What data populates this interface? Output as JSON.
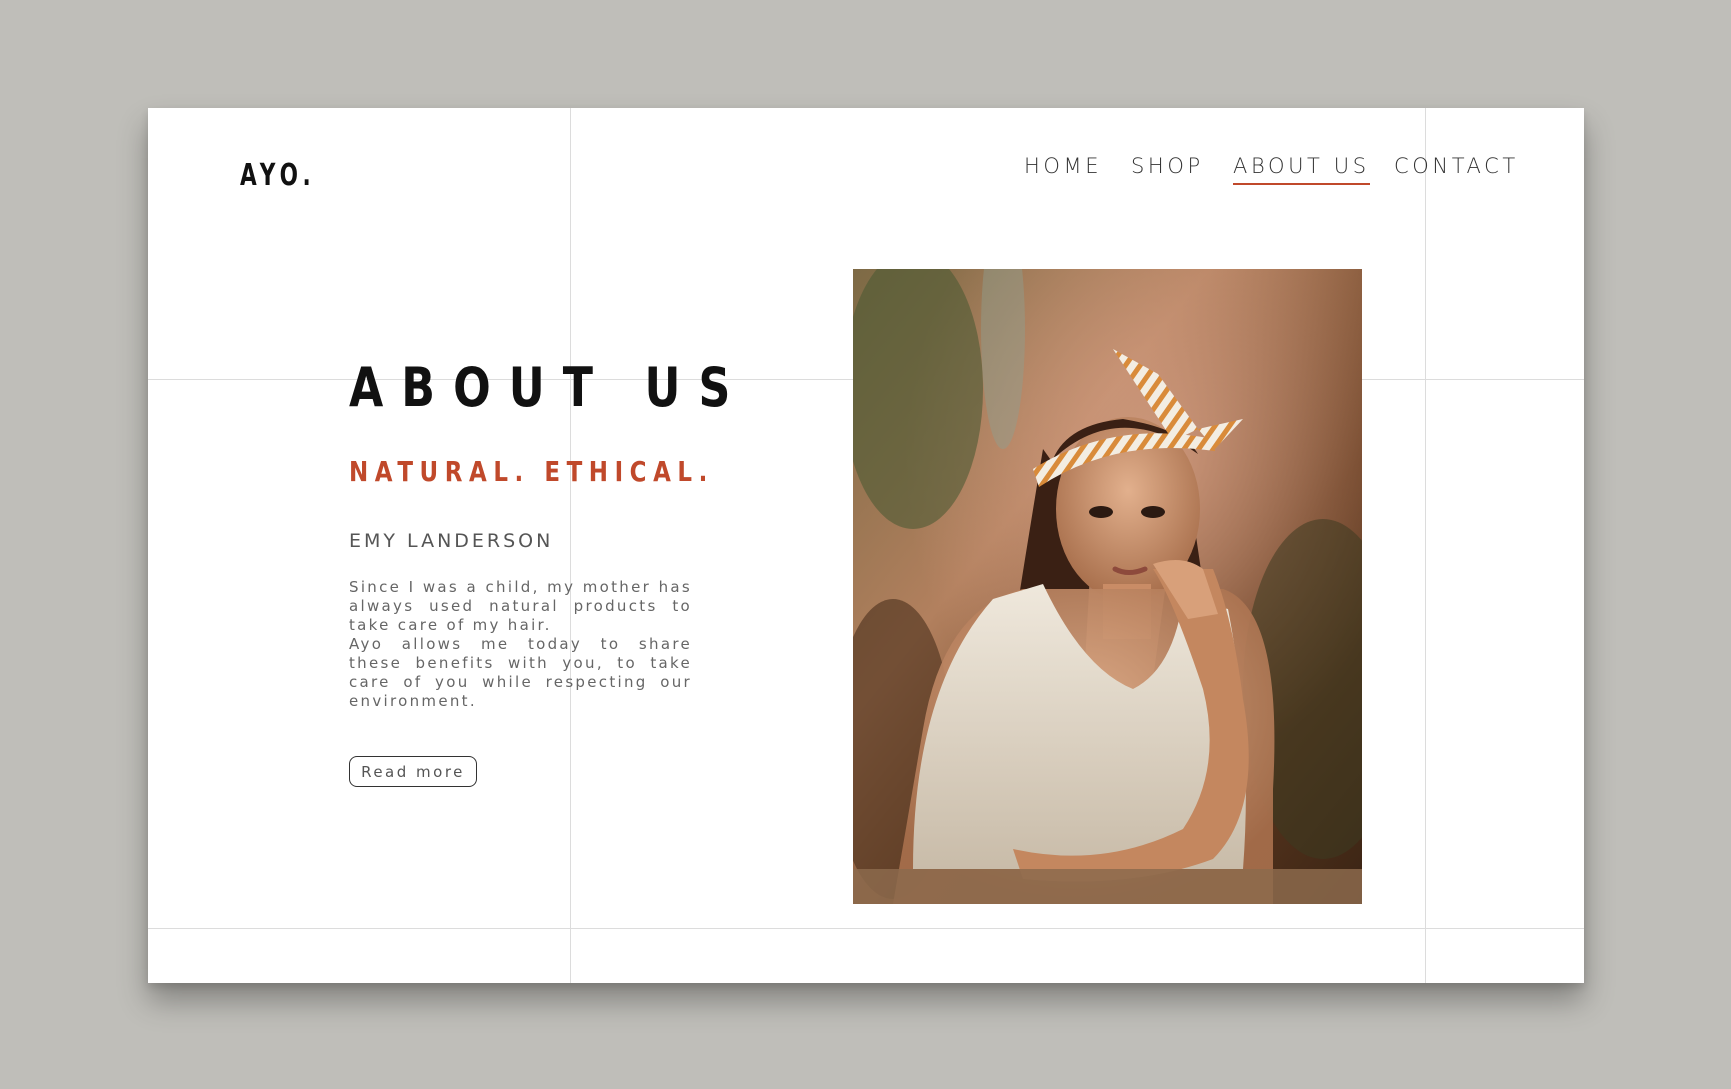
{
  "brand": {
    "logo": "AYO."
  },
  "nav": {
    "items": [
      {
        "label": "HOME",
        "active": false
      },
      {
        "label": "SHOP",
        "active": false
      },
      {
        "label": "ABOUT US",
        "active": true
      },
      {
        "label": "CONTACT",
        "active": false
      }
    ]
  },
  "hero": {
    "title": "ABOUT US",
    "tagline": "NATURAL. ETHICAL.",
    "author": "EMY LANDERSON",
    "paragraphs": [
      "Since I was a child, my mother has always used natural products to take care of my hair.",
      "Ayo allows me today to share these benefits with you, to take care of you while respecting our environment."
    ],
    "read_more_label": "Read more"
  },
  "colors": {
    "accent": "#c0492b",
    "page_background": "#bfbeb9",
    "card_background": "#ffffff",
    "text_dark": "#111111"
  },
  "image": {
    "description_icon": "portrait-photo"
  }
}
